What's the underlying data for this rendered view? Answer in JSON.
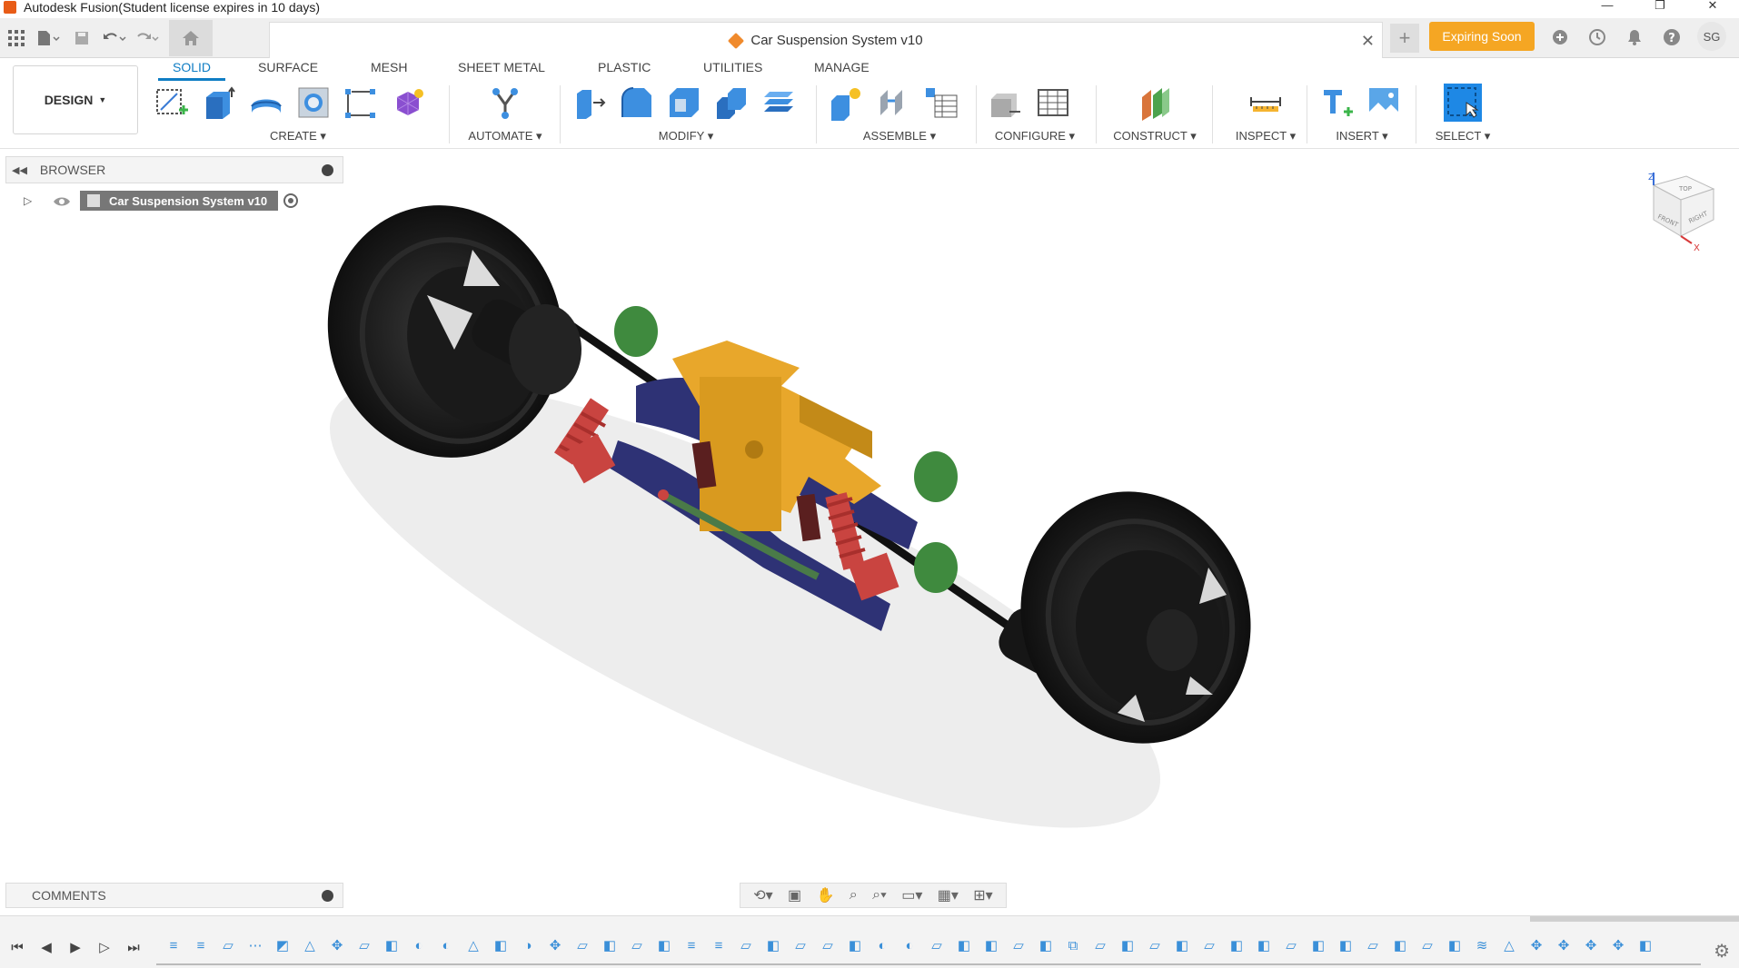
{
  "window": {
    "title": "Autodesk Fusion(Student license expires in 10 days)",
    "minimize": "—",
    "restore": "❐",
    "close": "✕"
  },
  "tabs": {
    "document_title": "Car Suspension System v10",
    "close_symbol": "✕",
    "new_tab_symbol": "+",
    "expiring_label": "Expiring Soon",
    "user_initials": "SG"
  },
  "ribbon": {
    "workspace_label": "DESIGN",
    "tabs": [
      "SOLID",
      "SURFACE",
      "MESH",
      "SHEET METAL",
      "PLASTIC",
      "UTILITIES",
      "MANAGE"
    ],
    "groups": [
      "CREATE",
      "AUTOMATE",
      "MODIFY",
      "ASSEMBLE",
      "CONFIGURE",
      "CONSTRUCT",
      "INSPECT",
      "INSERT",
      "SELECT"
    ]
  },
  "browser": {
    "title": "BROWSER",
    "root_node": "Car Suspension System v10"
  },
  "comments": {
    "title": "COMMENTS"
  },
  "viewcube": {
    "axis_z": "Z",
    "axis_x": "X",
    "face_top": "TOP",
    "face_front": "FRONT",
    "face_right": "RIGHT"
  },
  "colors": {
    "accent": "#0f7dc4",
    "expiring": "#f5a623",
    "tire": "#1c1c1c",
    "frame_yellow": "#e8a72b",
    "arm_navy": "#2e3275",
    "bushing_green": "#3f8a3e",
    "spring_red": "#c94440"
  }
}
